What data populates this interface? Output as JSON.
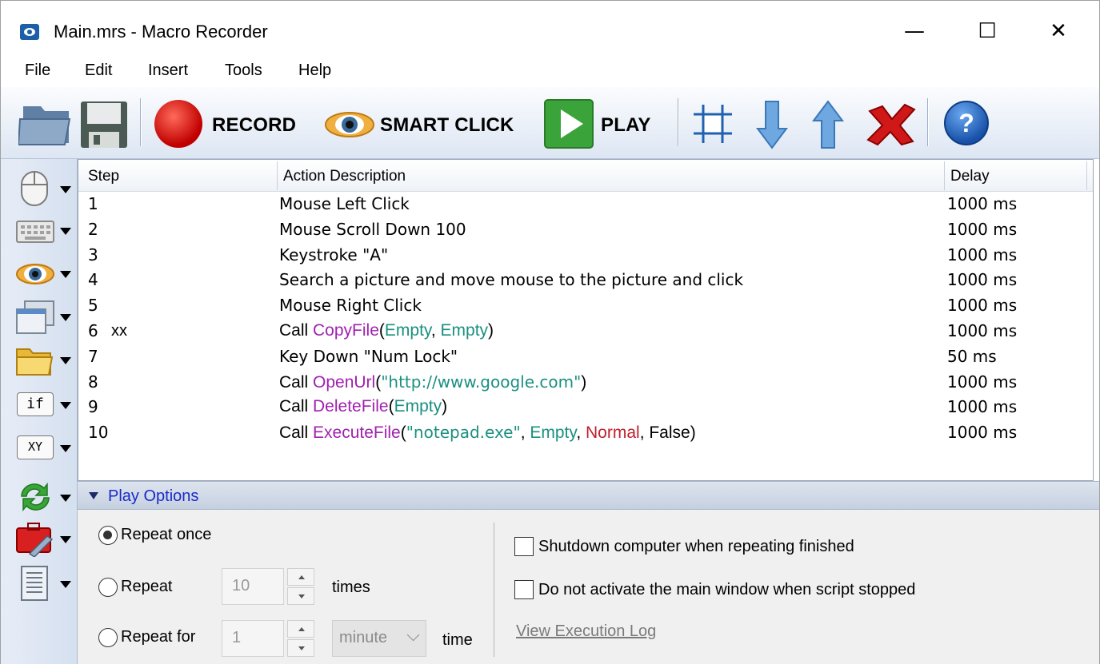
{
  "window": {
    "title": "Main.mrs - Macro Recorder",
    "controls": {
      "minimize": "—",
      "maximize": "☐",
      "close": "✕"
    }
  },
  "menu": [
    "File",
    "Edit",
    "Insert",
    "Tools",
    "Help"
  ],
  "toolbar": {
    "open_icon": "folder-open-icon",
    "save_icon": "floppy-save-icon",
    "record_label": "RECORD",
    "smart_click_label": "SMART CLICK",
    "play_label": "PLAY",
    "tools": [
      "select-area-icon",
      "move-down-icon",
      "move-up-icon",
      "delete-icon",
      "help-icon"
    ]
  },
  "sidebar": [
    "mouse-icon",
    "keyboard-icon",
    "eye-icon",
    "window-icon",
    "folder-icon",
    "if-icon",
    "xy-icon",
    "loop-icon",
    "tools-icon",
    "script-icon"
  ],
  "sidebar_text": {
    "if": "if",
    "xy": "XY"
  },
  "steps": {
    "headers": {
      "step": "Step",
      "action": "Action Description",
      "delay": "Delay"
    },
    "rows": [
      {
        "step": "1",
        "action": "Mouse Left Click",
        "delay": "1000 ms"
      },
      {
        "step": "2",
        "action": "Mouse Scroll Down 100",
        "delay": "1000 ms"
      },
      {
        "step": "3",
        "action": "Keystroke \"A\"",
        "delay": "1000 ms"
      },
      {
        "step": "4",
        "action": "Search a picture and move mouse to the picture and click",
        "delay": "1000 ms"
      },
      {
        "step": "5",
        "action": "Mouse Right Click",
        "delay": "1000 ms"
      },
      {
        "step": "6",
        "label": "xx",
        "call": "Call ",
        "fn": "CopyFile",
        "open": "(",
        "a1": "Empty",
        "c1": ", ",
        "a2": "Empty",
        "close": ")",
        "delay": "1000 ms"
      },
      {
        "step": "7",
        "action": "Key Down \"Num Lock\"",
        "delay": "50 ms"
      },
      {
        "step": "8",
        "call": "Call ",
        "fn": "OpenUrl",
        "open": "(",
        "a1": "\"http://www.google.com\"",
        "close": ")",
        "delay": "1000 ms"
      },
      {
        "step": "9",
        "call": "Call ",
        "fn": "DeleteFile",
        "open": "(",
        "a1": "Empty",
        "close": ")",
        "delay": "1000 ms"
      },
      {
        "step": "10",
        "call": "Call ",
        "fn": "ExecuteFile",
        "open": "(",
        "a1": "\"notepad.exe\"",
        "c1": ", ",
        "a2": "Empty",
        "c2": ", ",
        "a3": "Normal",
        "c3": ", False",
        "close": ")",
        "delay": "1000 ms"
      }
    ]
  },
  "play_options": {
    "header": "Play Options",
    "repeat_once": "Repeat once",
    "repeat": "Repeat",
    "repeat_count": "10",
    "times": "times",
    "repeat_for": "Repeat for",
    "repeat_for_value": "1",
    "unit": "minute",
    "time": "time",
    "shutdown": "Shutdown computer when repeating finished",
    "no_activate": "Do not activate the main window when script stopped",
    "view_log": "View Execution Log"
  }
}
